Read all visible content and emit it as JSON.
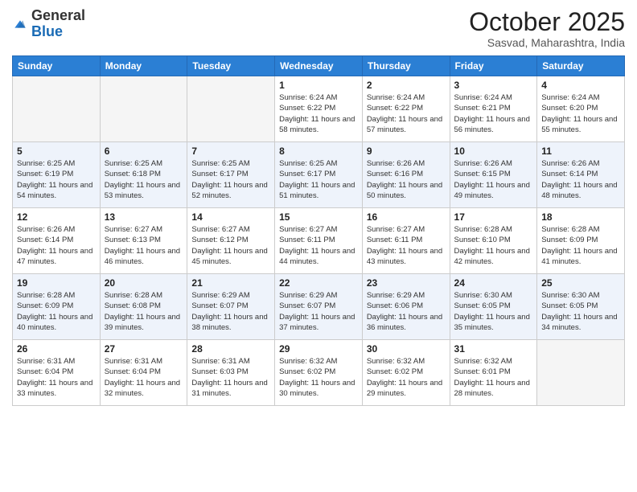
{
  "header": {
    "logo_general": "General",
    "logo_blue": "Blue",
    "month_title": "October 2025",
    "subtitle": "Sasvad, Maharashtra, India"
  },
  "days_of_week": [
    "Sunday",
    "Monday",
    "Tuesday",
    "Wednesday",
    "Thursday",
    "Friday",
    "Saturday"
  ],
  "weeks": [
    [
      {
        "day": "",
        "empty": true
      },
      {
        "day": "",
        "empty": true
      },
      {
        "day": "",
        "empty": true
      },
      {
        "day": "1",
        "sunrise": "6:24 AM",
        "sunset": "6:22 PM",
        "daylight": "11 hours and 58 minutes."
      },
      {
        "day": "2",
        "sunrise": "6:24 AM",
        "sunset": "6:22 PM",
        "daylight": "11 hours and 57 minutes."
      },
      {
        "day": "3",
        "sunrise": "6:24 AM",
        "sunset": "6:21 PM",
        "daylight": "11 hours and 56 minutes."
      },
      {
        "day": "4",
        "sunrise": "6:24 AM",
        "sunset": "6:20 PM",
        "daylight": "11 hours and 55 minutes."
      }
    ],
    [
      {
        "day": "5",
        "sunrise": "6:25 AM",
        "sunset": "6:19 PM",
        "daylight": "11 hours and 54 minutes."
      },
      {
        "day": "6",
        "sunrise": "6:25 AM",
        "sunset": "6:18 PM",
        "daylight": "11 hours and 53 minutes."
      },
      {
        "day": "7",
        "sunrise": "6:25 AM",
        "sunset": "6:17 PM",
        "daylight": "11 hours and 52 minutes."
      },
      {
        "day": "8",
        "sunrise": "6:25 AM",
        "sunset": "6:17 PM",
        "daylight": "11 hours and 51 minutes."
      },
      {
        "day": "9",
        "sunrise": "6:26 AM",
        "sunset": "6:16 PM",
        "daylight": "11 hours and 50 minutes."
      },
      {
        "day": "10",
        "sunrise": "6:26 AM",
        "sunset": "6:15 PM",
        "daylight": "11 hours and 49 minutes."
      },
      {
        "day": "11",
        "sunrise": "6:26 AM",
        "sunset": "6:14 PM",
        "daylight": "11 hours and 48 minutes."
      }
    ],
    [
      {
        "day": "12",
        "sunrise": "6:26 AM",
        "sunset": "6:14 PM",
        "daylight": "11 hours and 47 minutes."
      },
      {
        "day": "13",
        "sunrise": "6:27 AM",
        "sunset": "6:13 PM",
        "daylight": "11 hours and 46 minutes."
      },
      {
        "day": "14",
        "sunrise": "6:27 AM",
        "sunset": "6:12 PM",
        "daylight": "11 hours and 45 minutes."
      },
      {
        "day": "15",
        "sunrise": "6:27 AM",
        "sunset": "6:11 PM",
        "daylight": "11 hours and 44 minutes."
      },
      {
        "day": "16",
        "sunrise": "6:27 AM",
        "sunset": "6:11 PM",
        "daylight": "11 hours and 43 minutes."
      },
      {
        "day": "17",
        "sunrise": "6:28 AM",
        "sunset": "6:10 PM",
        "daylight": "11 hours and 42 minutes."
      },
      {
        "day": "18",
        "sunrise": "6:28 AM",
        "sunset": "6:09 PM",
        "daylight": "11 hours and 41 minutes."
      }
    ],
    [
      {
        "day": "19",
        "sunrise": "6:28 AM",
        "sunset": "6:09 PM",
        "daylight": "11 hours and 40 minutes."
      },
      {
        "day": "20",
        "sunrise": "6:28 AM",
        "sunset": "6:08 PM",
        "daylight": "11 hours and 39 minutes."
      },
      {
        "day": "21",
        "sunrise": "6:29 AM",
        "sunset": "6:07 PM",
        "daylight": "11 hours and 38 minutes."
      },
      {
        "day": "22",
        "sunrise": "6:29 AM",
        "sunset": "6:07 PM",
        "daylight": "11 hours and 37 minutes."
      },
      {
        "day": "23",
        "sunrise": "6:29 AM",
        "sunset": "6:06 PM",
        "daylight": "11 hours and 36 minutes."
      },
      {
        "day": "24",
        "sunrise": "6:30 AM",
        "sunset": "6:05 PM",
        "daylight": "11 hours and 35 minutes."
      },
      {
        "day": "25",
        "sunrise": "6:30 AM",
        "sunset": "6:05 PM",
        "daylight": "11 hours and 34 minutes."
      }
    ],
    [
      {
        "day": "26",
        "sunrise": "6:31 AM",
        "sunset": "6:04 PM",
        "daylight": "11 hours and 33 minutes."
      },
      {
        "day": "27",
        "sunrise": "6:31 AM",
        "sunset": "6:04 PM",
        "daylight": "11 hours and 32 minutes."
      },
      {
        "day": "28",
        "sunrise": "6:31 AM",
        "sunset": "6:03 PM",
        "daylight": "11 hours and 31 minutes."
      },
      {
        "day": "29",
        "sunrise": "6:32 AM",
        "sunset": "6:02 PM",
        "daylight": "11 hours and 30 minutes."
      },
      {
        "day": "30",
        "sunrise": "6:32 AM",
        "sunset": "6:02 PM",
        "daylight": "11 hours and 29 minutes."
      },
      {
        "day": "31",
        "sunrise": "6:32 AM",
        "sunset": "6:01 PM",
        "daylight": "11 hours and 28 minutes."
      },
      {
        "day": "",
        "empty": true
      }
    ]
  ],
  "labels": {
    "sunrise_label": "Sunrise:",
    "sunset_label": "Sunset:",
    "daylight_label": "Daylight:"
  }
}
